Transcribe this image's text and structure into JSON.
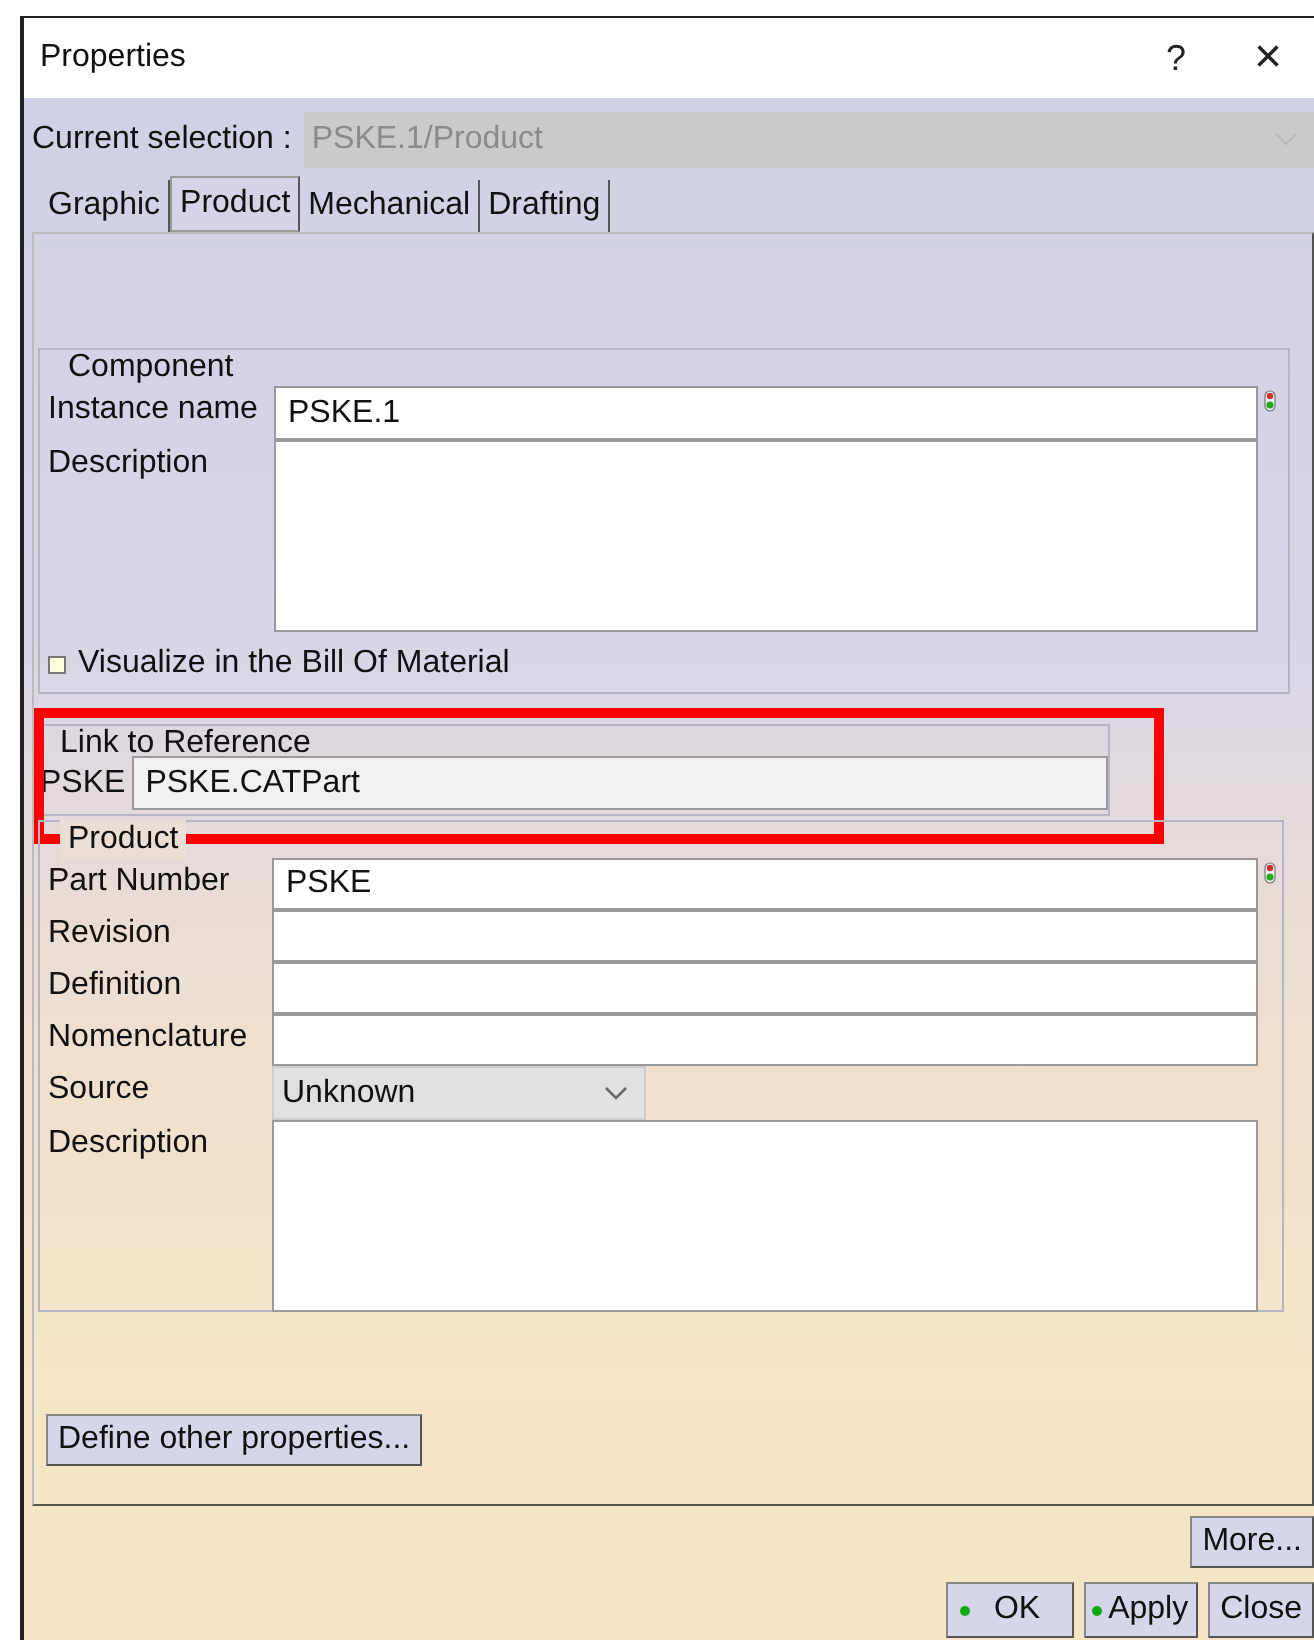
{
  "window": {
    "title": "Properties",
    "help": "?",
    "close": "×"
  },
  "current_selection": {
    "label": "Current selection :",
    "value": "PSKE.1/Product",
    "disabled": true
  },
  "tabs": [
    {
      "label": "Graphic",
      "selected": false
    },
    {
      "label": "Product",
      "selected": true
    },
    {
      "label": "Mechanical",
      "selected": false
    },
    {
      "label": "Drafting",
      "selected": false
    }
  ],
  "component": {
    "title": "Component",
    "instance_name": {
      "label": "Instance name",
      "value": "PSKE.1",
      "locked": true
    },
    "description": {
      "label": "Description"
    },
    "visualize_bom": {
      "label": "Visualize in the Bill Of Material",
      "checked": false
    }
  },
  "link_to_reference": {
    "title": "Link to Reference",
    "label": "PSKE",
    "value": "PSKE.CATPart",
    "highlighted": true
  },
  "product": {
    "title": "Product",
    "fields": [
      {
        "kind": "text",
        "label": "Part Number",
        "value": "PSKE",
        "locked": true
      },
      {
        "kind": "text",
        "label": "Revision",
        "locked": false
      },
      {
        "kind": "text",
        "label": "Definition",
        "locked": false
      },
      {
        "kind": "text",
        "label": "Nomenclature",
        "locked": false
      },
      {
        "kind": "select",
        "label": "Source",
        "value": "Unknown",
        "locked": false
      },
      {
        "kind": "area",
        "label": "Description",
        "locked": false
      }
    ]
  },
  "define_button": "Define other properties...",
  "more_button": "More...",
  "buttons": [
    {
      "label": "OK",
      "dot": true
    },
    {
      "label": "Apply",
      "dot": true
    },
    {
      "label": "Close",
      "dot": false
    }
  ]
}
